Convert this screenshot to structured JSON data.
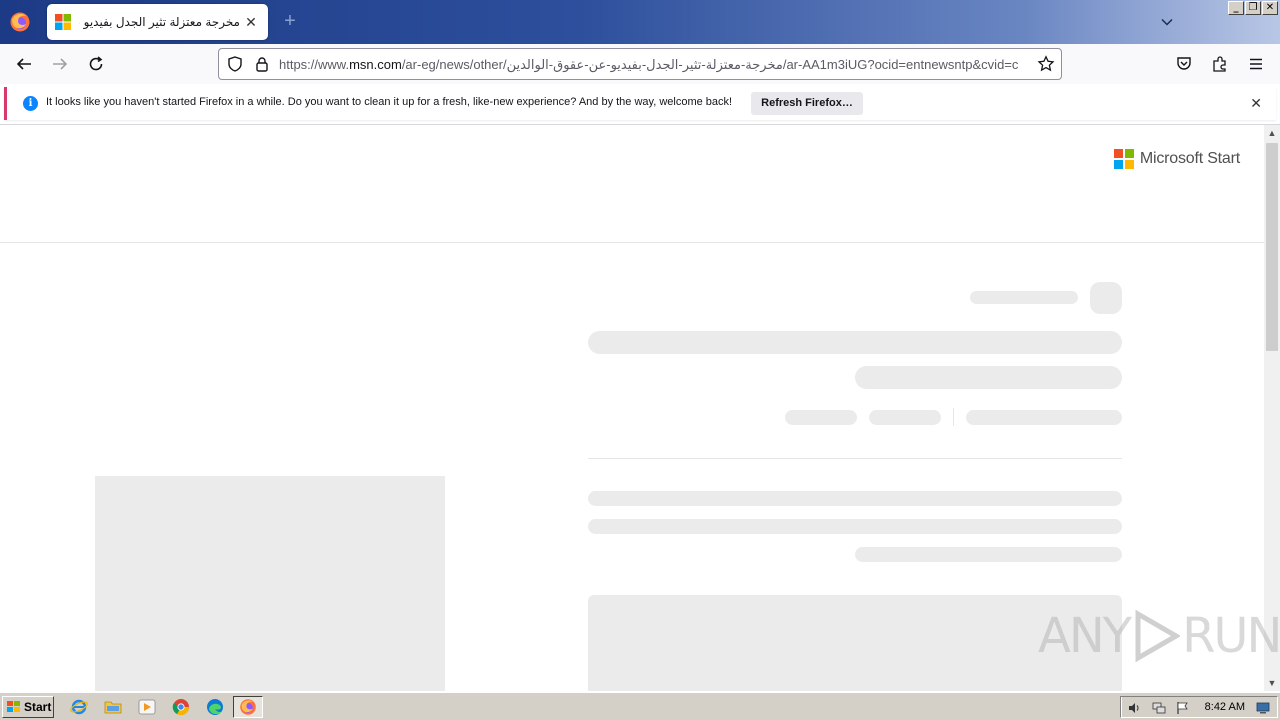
{
  "browser": {
    "tab": {
      "title": "مخرجة معتزلة تثير الجدل بفيديو عن",
      "favicon": "microsoft-logo-icon"
    },
    "url": {
      "prefix": "https://www.",
      "host": "msn.com",
      "path": "/ar-eg/news/other/مخرجة-معتزلة-تثير-الجدل-بفيديو-عن-عقوق-الوالدين/ar-AA1m3iUG?ocid=entnewsntp&cvid=c"
    },
    "notification": {
      "message": "It looks like you haven't started Firefox in a while. Do you want to clean it up for a fresh, like-new experience? And by the way, welcome back!",
      "button": "Refresh Firefox…"
    }
  },
  "page": {
    "brand": "Microsoft Start",
    "brand_colors": [
      "#f25022",
      "#7fba00",
      "#00a4ef",
      "#ffb900"
    ]
  },
  "watermark": {
    "left": "ANY",
    "right": "RUN"
  },
  "taskbar": {
    "start_label": "Start",
    "clock": "8:42 AM"
  },
  "colors": {
    "accent_info": "#0a84ff",
    "notification_border": "#d7396b",
    "skeleton": "#ebebeb",
    "tabstrip_start": "#1d3a86"
  }
}
